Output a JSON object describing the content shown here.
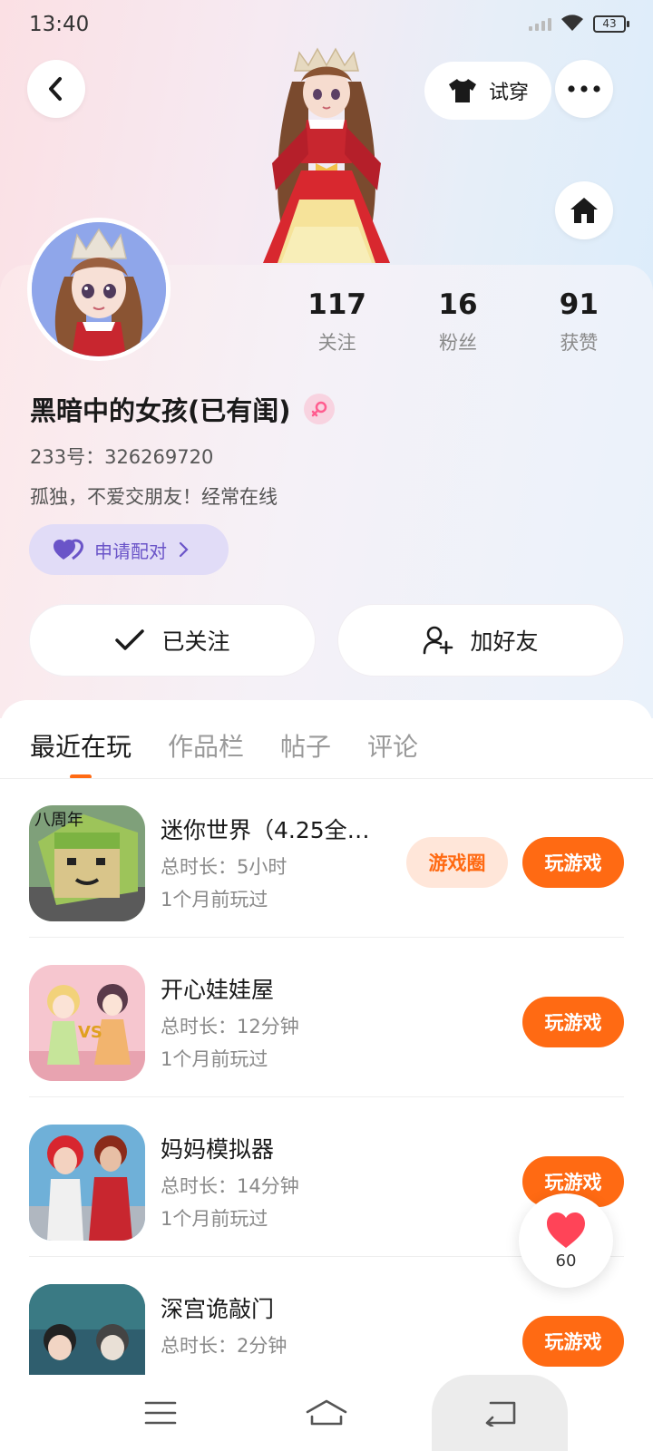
{
  "status_bar": {
    "time": "13:40",
    "battery": "43"
  },
  "header": {
    "tryon_label": "试穿"
  },
  "profile": {
    "stats": [
      {
        "value": "117",
        "label": "关注"
      },
      {
        "value": "16",
        "label": "粉丝"
      },
      {
        "value": "91",
        "label": "获赞"
      }
    ],
    "nickname": "黑暗中的女孩(已有闺)",
    "user_id": "233号：326269720",
    "bio": "孤独，不爱交朋友！经常在线",
    "pair_label": "申请配对",
    "follow_label": "已关注",
    "add_friend_label": "加好友"
  },
  "tabs": [
    {
      "label": "最近在玩",
      "active": true
    },
    {
      "label": "作品栏",
      "active": false
    },
    {
      "label": "帖子",
      "active": false
    },
    {
      "label": "评论",
      "active": false
    }
  ],
  "games": [
    {
      "title": "迷你世界（4.25全…",
      "duration": "总时长：5小时",
      "last_played": "1个月前玩过",
      "circle_label": "游戏圈",
      "play_label": "玩游戏"
    },
    {
      "title": "开心娃娃屋",
      "duration": "总时长：12分钟",
      "last_played": "1个月前玩过",
      "play_label": "玩游戏"
    },
    {
      "title": "妈妈模拟器",
      "duration": "总时长：14分钟",
      "last_played": "1个月前玩过",
      "play_label": "玩游戏"
    },
    {
      "title": "深宫诡敲门",
      "duration": "总时长：2分钟",
      "last_played": "",
      "play_label": "玩游戏"
    }
  ],
  "like_float": {
    "count": "60"
  },
  "colors": {
    "accent": "#ff6a13",
    "pair_purple": "#6a54c8",
    "heart_red": "#ff4458"
  }
}
